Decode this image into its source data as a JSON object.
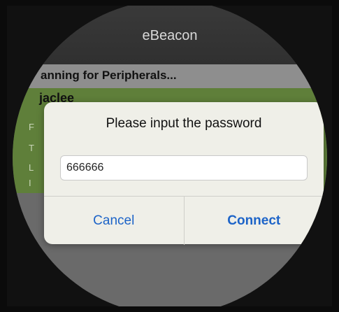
{
  "app": {
    "title": "eBeacon"
  },
  "status": {
    "text": "anning for Peripherals..."
  },
  "device": {
    "name": "jaclee",
    "field_initials": [
      "F",
      "T",
      "L",
      "I"
    ]
  },
  "dialog": {
    "title": "Please input the password",
    "password_value": "666666",
    "cancel_label": "Cancel",
    "connect_label": "Connect"
  },
  "colors": {
    "accent": "#1d64c8",
    "list_green": "#5f7f3a"
  }
}
